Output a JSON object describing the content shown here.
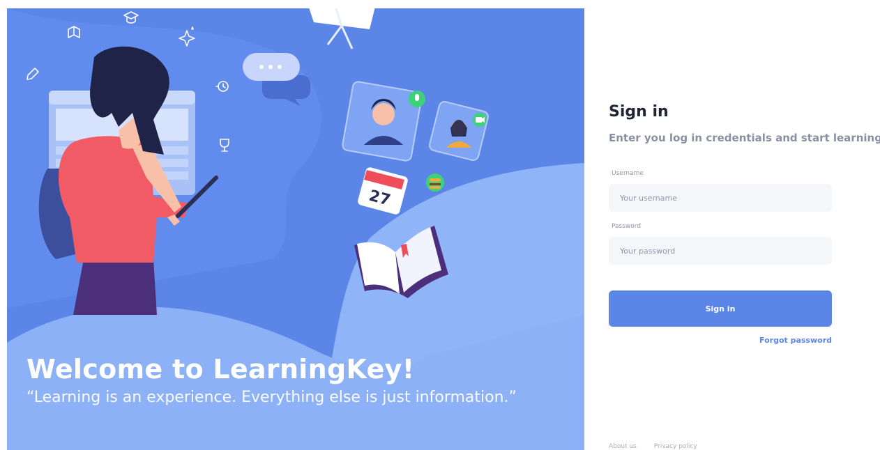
{
  "hero": {
    "welcome_title": "Welcome to LearningKey!",
    "quote": "“Learning is an experience. Everything else is just information.”",
    "calendar_day": "27",
    "background_color": "#5b86e8"
  },
  "signin": {
    "title": "Sign in",
    "subtitle": "Enter you log in credentials and start learning.",
    "username_label": "Username",
    "username_placeholder": "Your username",
    "username_value": "",
    "password_label": "Password",
    "password_placeholder": "Your password",
    "password_value": "",
    "submit_label": "Sign in",
    "forgot_label": "Forgot password",
    "accent_color": "#5b86e8"
  },
  "footer": {
    "links": [
      "About us",
      "Privacy policy"
    ]
  },
  "icons": [
    "book-icon",
    "graduation-cap-icon",
    "sparkle-icon",
    "pencil-icon",
    "history-icon",
    "trophy-icon",
    "chat-bubble-icon",
    "mic-icon",
    "video-icon",
    "calendar-icon",
    "open-book-icon",
    "burger-icon"
  ]
}
